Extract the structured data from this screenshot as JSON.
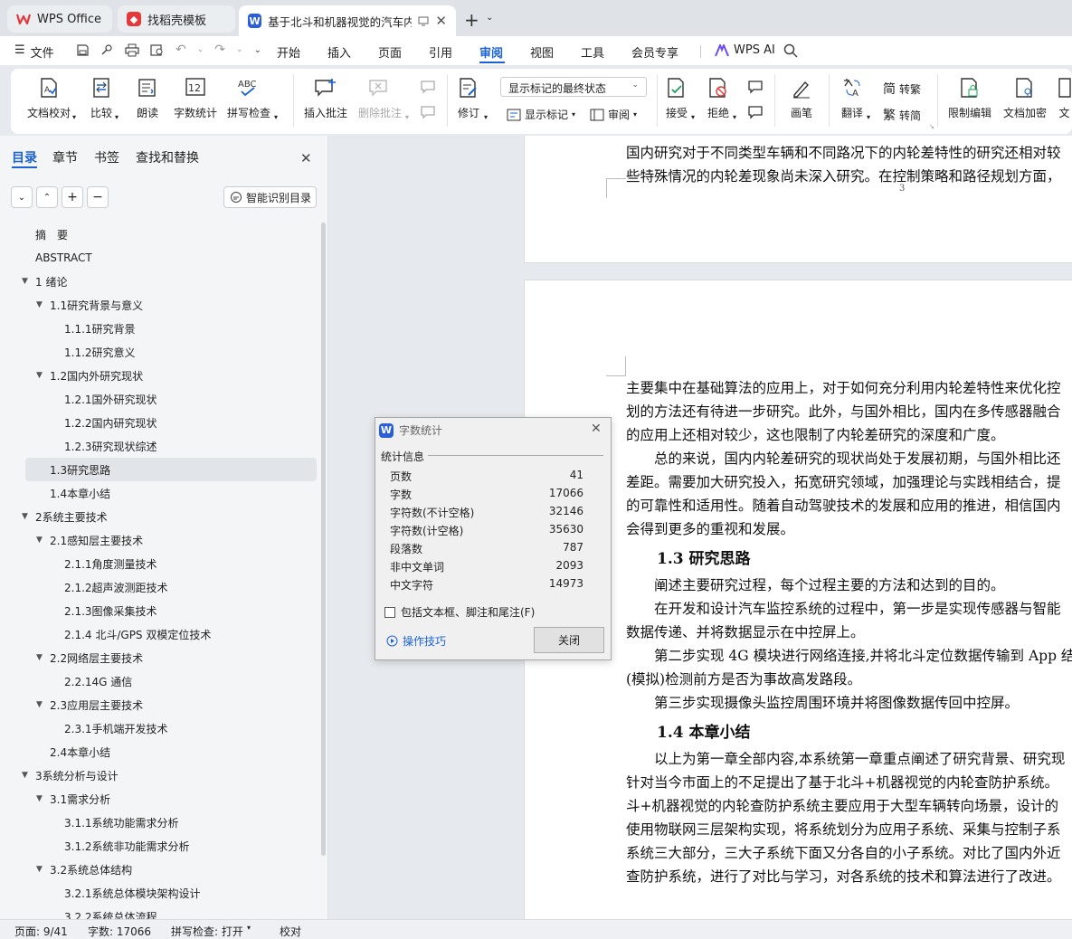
{
  "tabs": [
    {
      "label": "WPS Office"
    },
    {
      "label": "找稻壳模板"
    },
    {
      "label": "基于北斗和机器视觉的汽车内轮"
    }
  ],
  "menu": {
    "file": "文件",
    "items": [
      "开始",
      "插入",
      "页面",
      "引用",
      "审阅",
      "视图",
      "工具",
      "会员专享"
    ],
    "ai": "WPS AI",
    "active": "审阅"
  },
  "ribbon": {
    "proof": "文档校对",
    "compare": "比较",
    "read": "朗读",
    "wordcount": "字数统计",
    "spell": "拼写检查",
    "add_comment": "插入批注",
    "del_comment": "删除批注",
    "revise": "修订",
    "markup_state": "显示标记的最终状态",
    "show_markup": "显示标记",
    "review": "审阅",
    "accept": "接受",
    "reject": "拒绝",
    "pen": "画笔",
    "translate": "翻译",
    "to_trad": "转繁",
    "to_simp": "转简",
    "restrict": "限制编辑",
    "encrypt": "文档加密",
    "more": "文"
  },
  "nav": {
    "tabs": [
      "目录",
      "章节",
      "书签",
      "查找和替换"
    ],
    "smart_toc": "智能识别目录",
    "toc": [
      {
        "label": "摘　要",
        "level": 0,
        "expand": ""
      },
      {
        "label": "ABSTRACT",
        "level": 0,
        "expand": ""
      },
      {
        "label": "1 绪论",
        "level": 0,
        "expand": "▼"
      },
      {
        "label": "1.1研究背景与意义",
        "level": 1,
        "expand": "▼"
      },
      {
        "label": "1.1.1研究背景",
        "level": 2,
        "expand": ""
      },
      {
        "label": "1.1.2研究意义",
        "level": 2,
        "expand": ""
      },
      {
        "label": "1.2国内外研究现状",
        "level": 1,
        "expand": "▼"
      },
      {
        "label": "1.2.1国外研究现状",
        "level": 2,
        "expand": ""
      },
      {
        "label": "1.2.2国内研究现状",
        "level": 2,
        "expand": ""
      },
      {
        "label": "1.2.3研究现状综述",
        "level": 2,
        "expand": ""
      },
      {
        "label": "1.3研究思路",
        "level": 1,
        "expand": "",
        "selected": true
      },
      {
        "label": "1.4本章小结",
        "level": 1,
        "expand": ""
      },
      {
        "label": "2系统主要技术",
        "level": 0,
        "expand": "▼"
      },
      {
        "label": "2.1感知层主要技术",
        "level": 1,
        "expand": "▼"
      },
      {
        "label": "2.1.1角度测量技术",
        "level": 2,
        "expand": ""
      },
      {
        "label": "2.1.2超声波测距技术",
        "level": 2,
        "expand": ""
      },
      {
        "label": "2.1.3图像采集技术",
        "level": 2,
        "expand": ""
      },
      {
        "label": "2.1.4  北斗/GPS 双模定位技术",
        "level": 2,
        "expand": ""
      },
      {
        "label": "2.2网络层主要技术",
        "level": 1,
        "expand": "▼"
      },
      {
        "label": "2.2.14G 通信",
        "level": 2,
        "expand": ""
      },
      {
        "label": "2.3应用层主要技术",
        "level": 1,
        "expand": "▼"
      },
      {
        "label": "2.3.1手机端开发技术",
        "level": 2,
        "expand": ""
      },
      {
        "label": "2.4本章小结",
        "level": 1,
        "expand": ""
      },
      {
        "label": "3系统分析与设计",
        "level": 0,
        "expand": "▼"
      },
      {
        "label": "3.1需求分析",
        "level": 1,
        "expand": "▼"
      },
      {
        "label": "3.1.1系统功能需求分析",
        "level": 2,
        "expand": ""
      },
      {
        "label": "3.1.2系统非功能需求分析",
        "level": 2,
        "expand": ""
      },
      {
        "label": "3.2系统总体结构",
        "level": 1,
        "expand": "▼"
      },
      {
        "label": "3.2.1系统总体模块架构设计",
        "level": 2,
        "expand": ""
      },
      {
        "label": "3.2.2系统总体流程",
        "level": 2,
        "expand": ""
      }
    ]
  },
  "doc": {
    "page1": [
      "国内研究对于不同类型车辆和不同路况下的内轮差特性的研究还相对较",
      "些特殊情况的内轮差现象尚未深入研究。在控制策略和路径规划方面，"
    ],
    "page_number": "3",
    "page2": [
      {
        "t": "p",
        "text": "主要集中在基础算法的应用上，对于如何充分利用内轮差特性来优化控"
      },
      {
        "t": "p",
        "text": "划的方法还有待进一步研究。此外，与国外相比，国内在多传感器融合"
      },
      {
        "t": "p",
        "text": "的应用上还相对较少，这也限制了内轮差研究的深度和广度。"
      },
      {
        "t": "p",
        "text": "　　总的来说，国内内轮差研究的现状尚处于发展初期，与国外相比还"
      },
      {
        "t": "p",
        "text": "差距。需要加大研究投入，拓宽研究领域，加强理论与实践相结合，提"
      },
      {
        "t": "p",
        "text": "的可靠性和适用性。随着自动驾驶技术的发展和应用的推进，相信国内"
      },
      {
        "t": "p",
        "text": "会得到更多的重视和发展。"
      },
      {
        "t": "h",
        "text": "1.3  研究思路"
      },
      {
        "t": "p",
        "text": "　　阐述主要研究过程，每个过程主要的方法和达到的目的。"
      },
      {
        "t": "p",
        "text": "　　在开发和设计汽车监控系统的过程中，第一步是实现传感器与智能"
      },
      {
        "t": "p",
        "text": "数据传递、并将数据显示在中控屏上。"
      },
      {
        "t": "p",
        "text": "　　第二步实现 4G 模块进行网络连接,并将北斗定位数据传输到 App 结"
      },
      {
        "t": "p",
        "text": "(模拟)检测前方是否为事故高发路段。"
      },
      {
        "t": "p",
        "text": "　　第三步实现摄像头监控周围环境并将图像数据传回中控屏。"
      },
      {
        "t": "h",
        "text": "1.4  本章小结"
      },
      {
        "t": "p",
        "text": "　　以上为第一章全部内容,本系统第一章重点阐述了研究背景、研究现"
      },
      {
        "t": "p",
        "text": "针对当今市面上的不足提出了基于北斗+机器视觉的内轮查防护系统。"
      },
      {
        "t": "p",
        "text": "斗+机器视觉的内轮查防护系统主要应用于大型车辆转向场景，设计的"
      },
      {
        "t": "p",
        "text": "使用物联网三层架构实现，将系统划分为应用子系统、采集与控制子系"
      },
      {
        "t": "p",
        "text": "系统三大部分，三大子系统下面又分各自的小子系统。对比了国内外近"
      },
      {
        "t": "p",
        "text": "查防护系统，进行了对比与学习，对各系统的技术和算法进行了改进。"
      }
    ]
  },
  "dialog": {
    "title": "字数统计",
    "group": "统计信息",
    "stats": [
      {
        "label": "页数",
        "value": "41"
      },
      {
        "label": "字数",
        "value": "17066"
      },
      {
        "label": "字符数(不计空格)",
        "value": "32146"
      },
      {
        "label": "字符数(计空格)",
        "value": "35630"
      },
      {
        "label": "段落数",
        "value": "787"
      },
      {
        "label": "非中文单词",
        "value": "2093"
      },
      {
        "label": "中文字符",
        "value": "14973"
      }
    ],
    "checkbox": "包括文本框、脚注和尾注(F)",
    "tips": "操作技巧",
    "close": "关闭"
  },
  "status": {
    "page": "页面: 9/41",
    "words": "字数: 17066",
    "spell": "拼写检查: 打开",
    "proof": "校对"
  },
  "colors": {
    "accent": "#1a62d6",
    "wps_red": "#e4393c",
    "word_blue": "#2b5fd9"
  }
}
